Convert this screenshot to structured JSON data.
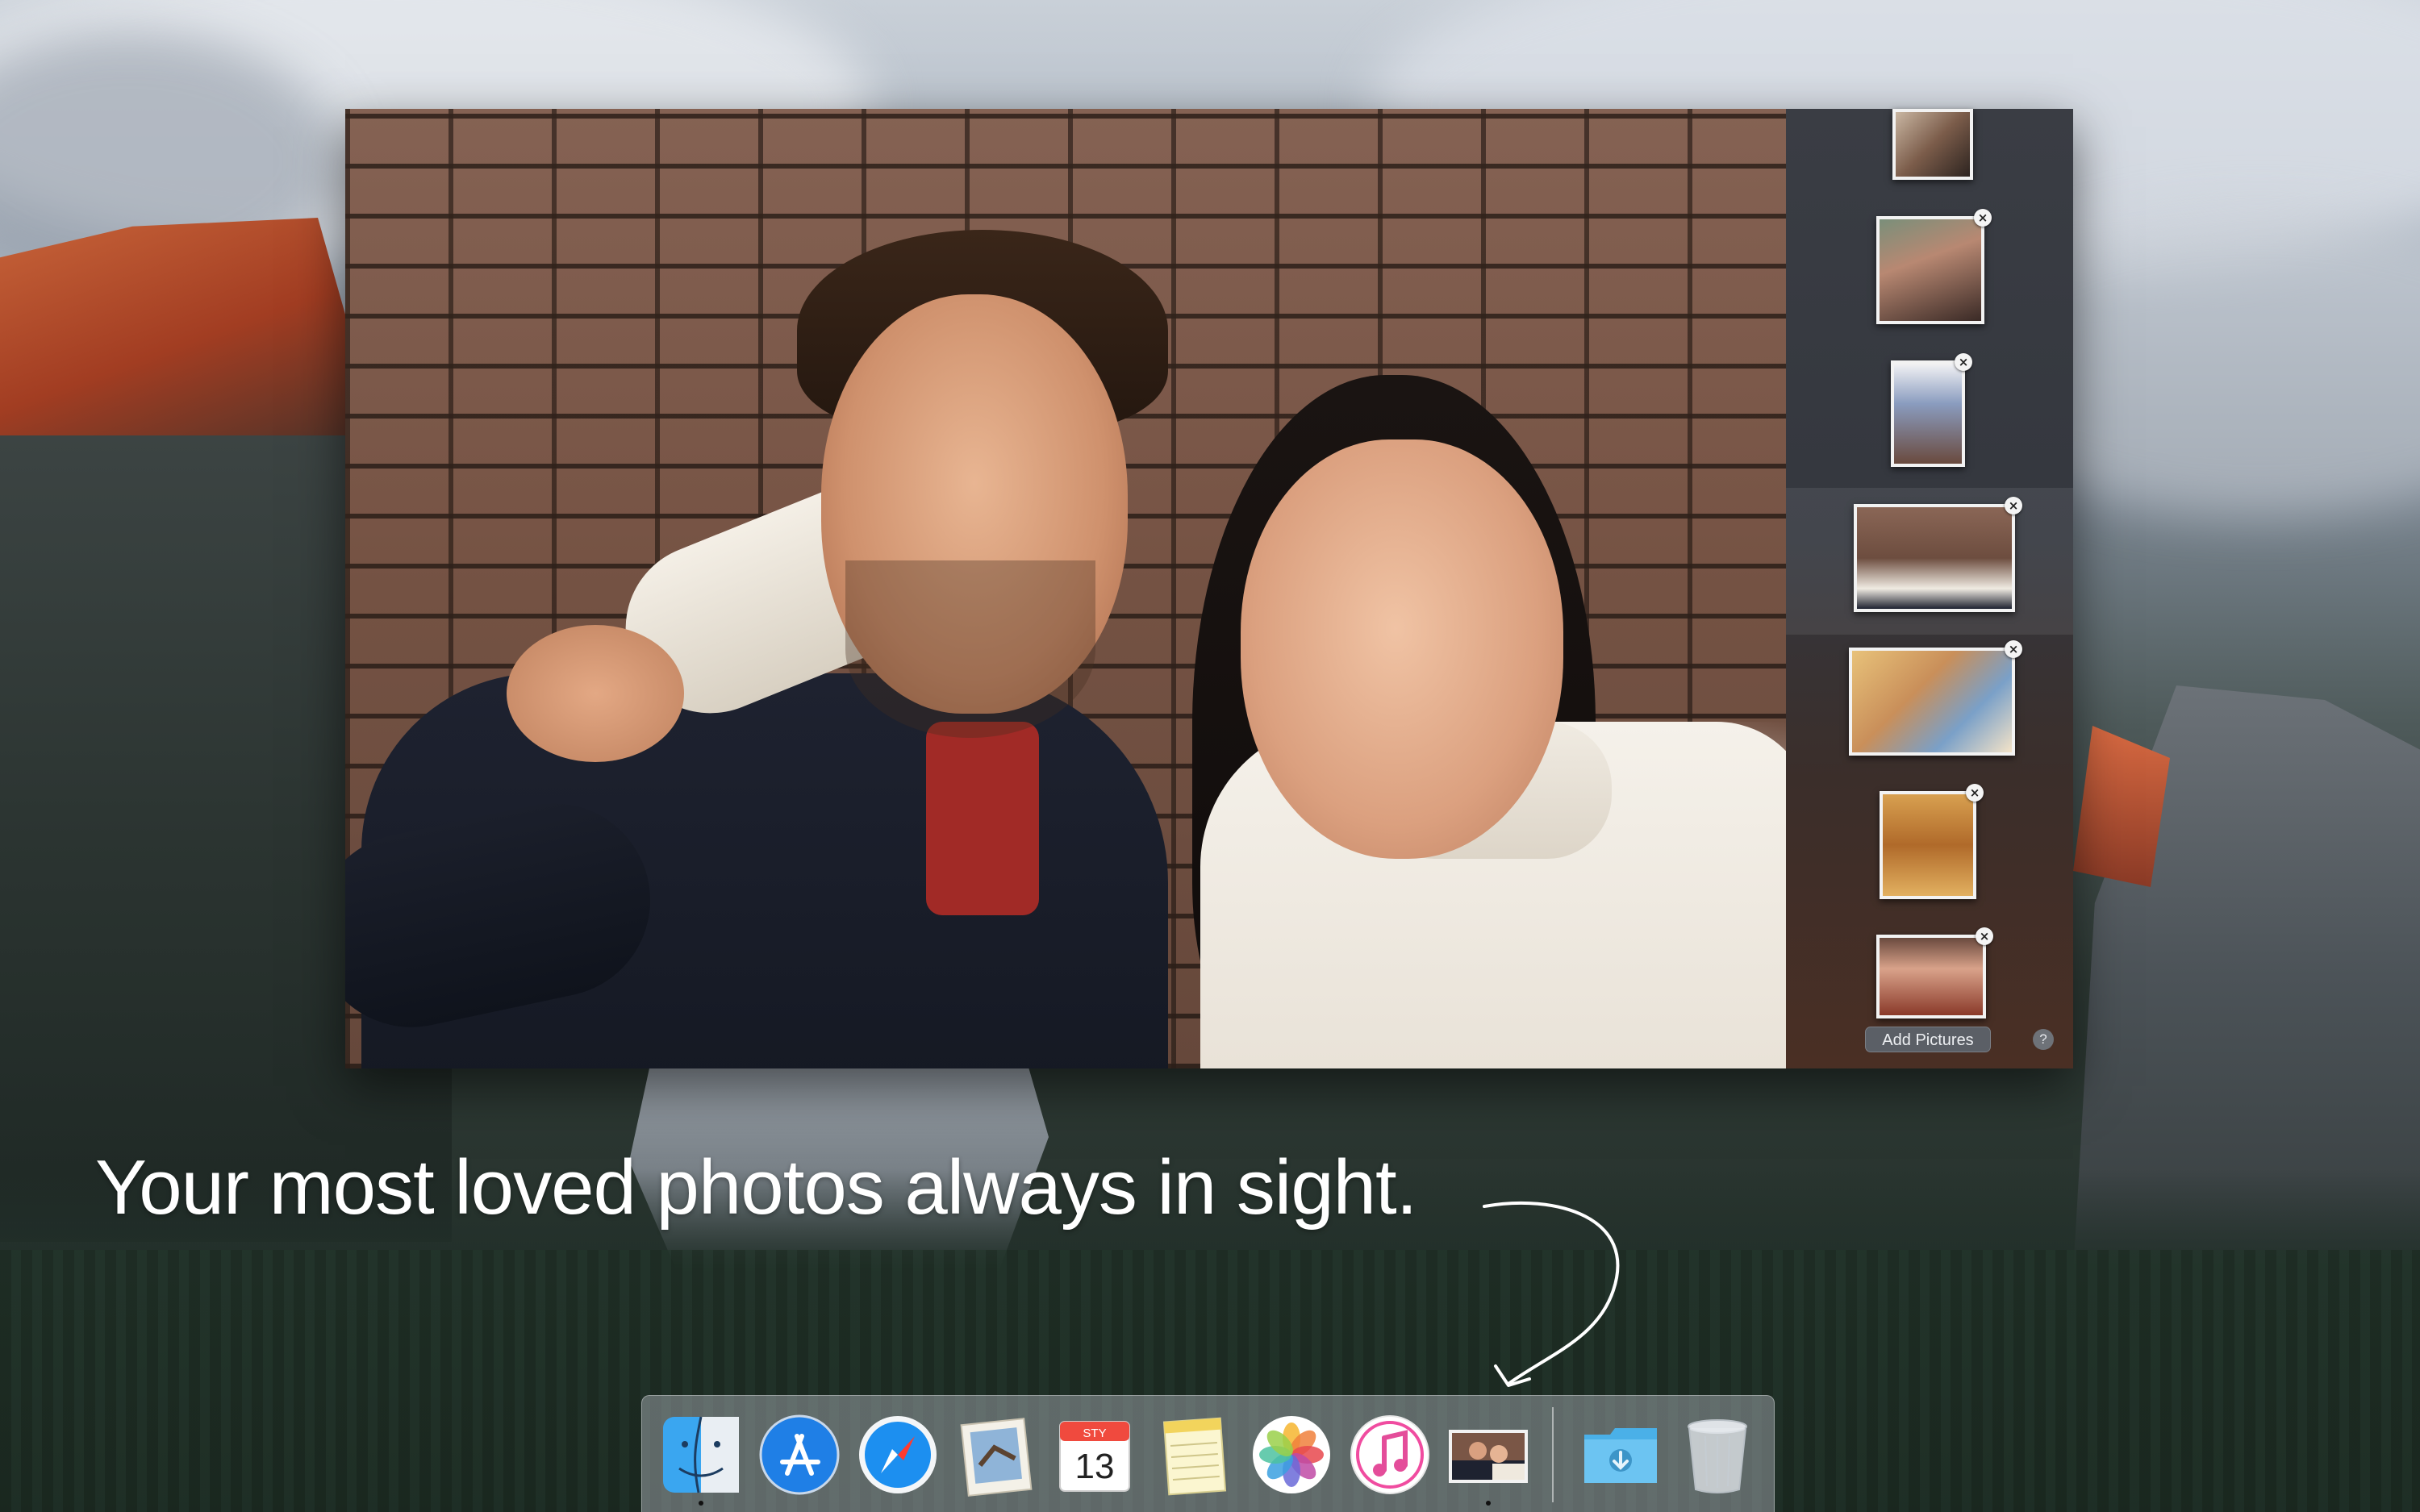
{
  "sidebar": {
    "add_pictures_label": "Add Pictures",
    "help_label": "?"
  },
  "tagline": "Your most loved photos always in sight.",
  "dock": {
    "calendar": {
      "month": "STY",
      "day": "13"
    },
    "items": [
      "Finder",
      "App Store",
      "Safari",
      "Mail",
      "Calendar",
      "Notes",
      "Photos",
      "iTunes",
      "Photo Widget",
      "Downloads",
      "Trash"
    ]
  },
  "colors": {
    "sidebar_bg": "#3a3d44",
    "dock_bg": "rgba(190,196,204,0.42)"
  },
  "icons": [
    "finder-icon",
    "app-store-icon",
    "safari-icon",
    "mail-icon",
    "calendar-icon",
    "notes-icon",
    "photos-icon",
    "itunes-icon",
    "photo-widget-icon",
    "downloads-folder-icon",
    "trash-icon",
    "close-icon",
    "help-icon"
  ]
}
